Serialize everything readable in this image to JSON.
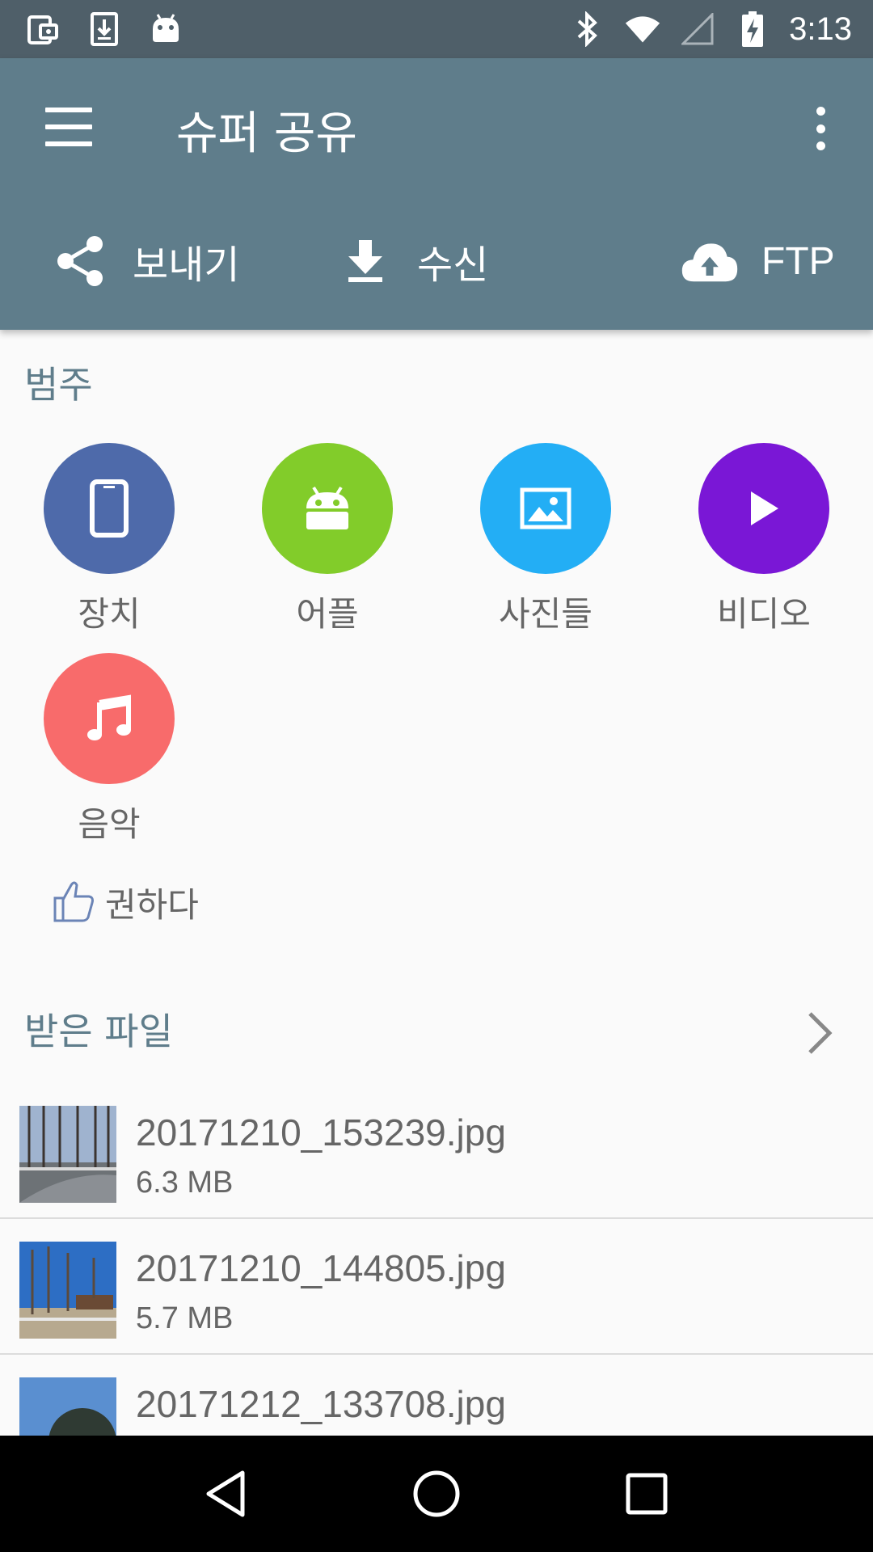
{
  "status_bar": {
    "time": "3:13",
    "left_icons": [
      "screenshot-icon",
      "download-icon",
      "android-icon"
    ],
    "right_icons": [
      "bluetooth-icon",
      "wifi-icon",
      "signal-icon",
      "battery-charging-icon"
    ]
  },
  "app_bar": {
    "title": "슈퍼 공유",
    "actions": [
      {
        "label": "보내기",
        "icon": "share-icon"
      },
      {
        "label": "수신",
        "icon": "download-icon"
      },
      {
        "label": "FTP",
        "icon": "cloud-upload-icon"
      }
    ]
  },
  "categories": {
    "title": "범주",
    "items": [
      {
        "label": "장치",
        "icon": "phone-icon",
        "color": "#4e6aaa"
      },
      {
        "label": "어플",
        "icon": "android-icon",
        "color": "#82cc2a"
      },
      {
        "label": "사진들",
        "icon": "image-icon",
        "color": "#23aef5"
      },
      {
        "label": "비디오",
        "icon": "play-icon",
        "color": "#7a17d6"
      },
      {
        "label": "음악",
        "icon": "music-note-icon",
        "color": "#f86b6b"
      }
    ]
  },
  "recommend": {
    "label": "권하다",
    "icon": "thumbs-up-icon"
  },
  "received": {
    "title": "받은 파일",
    "files": [
      {
        "name": "20171210_153239.jpg",
        "size": "6.3 MB"
      },
      {
        "name": "20171210_144805.jpg",
        "size": "5.7 MB"
      },
      {
        "name": "20171212_133708.jpg",
        "size": ""
      }
    ]
  },
  "colors": {
    "app_bar": "#5f7d8b",
    "status_bar": "#4f5f69",
    "accent_text": "#5f7d8b"
  }
}
